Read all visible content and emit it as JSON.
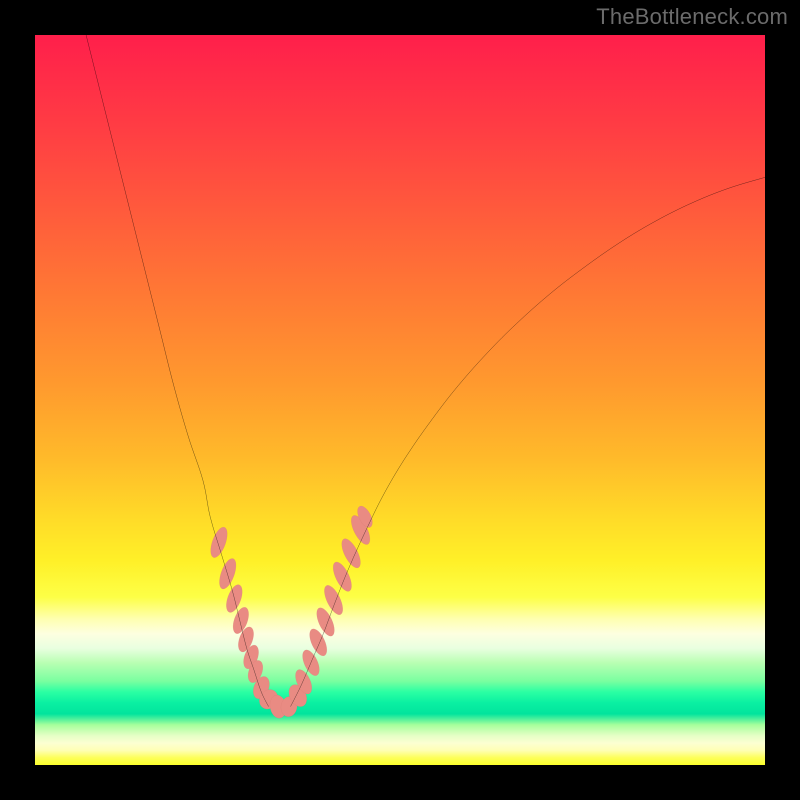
{
  "watermark": "TheBottleneck.com",
  "colors": {
    "marker_fill": "#e98b83",
    "marker_stroke": "#c66e66",
    "curve": "#000000"
  },
  "chart_data": {
    "type": "line",
    "title": "",
    "xlabel": "",
    "ylabel": "",
    "xlim": [
      0,
      100
    ],
    "ylim": [
      0,
      100
    ],
    "curve_left": {
      "comment": "Left descending branch of V curve; x in 0..100 of plot width, y in 0..100 of plot height (0=top)",
      "points": [
        [
          7,
          0
        ],
        [
          9,
          8
        ],
        [
          11,
          16
        ],
        [
          13,
          24
        ],
        [
          15,
          32
        ],
        [
          17,
          40
        ],
        [
          19,
          48
        ],
        [
          21,
          55
        ],
        [
          23,
          61
        ],
        [
          24,
          66
        ],
        [
          25.5,
          71
        ],
        [
          27,
          76
        ],
        [
          28,
          80
        ],
        [
          29,
          84
        ],
        [
          30,
          87
        ],
        [
          31,
          90
        ],
        [
          32,
          92
        ]
      ]
    },
    "curve_right": {
      "comment": "Right ascending branch of V curve",
      "points": [
        [
          35,
          92
        ],
        [
          36.5,
          89
        ],
        [
          38,
          85.5
        ],
        [
          39.5,
          82
        ],
        [
          41,
          78
        ],
        [
          43,
          73
        ],
        [
          45.5,
          67.5
        ],
        [
          48,
          62.5
        ],
        [
          51,
          57.5
        ],
        [
          54.5,
          52.5
        ],
        [
          58,
          48
        ],
        [
          62,
          43.5
        ],
        [
          66,
          39.5
        ],
        [
          70.5,
          35.5
        ],
        [
          75,
          32
        ],
        [
          80,
          28.5
        ],
        [
          85,
          25.5
        ],
        [
          90,
          23
        ],
        [
          95,
          21
        ],
        [
          100,
          19.5
        ]
      ]
    },
    "markers": {
      "comment": "Salmon elongated blobs near the valley on both branches. cx,cy,rx,ry,rot(deg) in 0..100 plot coords",
      "items": [
        [
          25.2,
          69.5,
          0.9,
          2.2,
          20
        ],
        [
          26.4,
          73.8,
          0.9,
          2.2,
          20
        ],
        [
          27.3,
          77.2,
          0.9,
          2.0,
          20
        ],
        [
          28.2,
          80.2,
          0.9,
          1.9,
          20
        ],
        [
          28.9,
          82.8,
          0.9,
          1.8,
          20
        ],
        [
          29.6,
          85.2,
          0.9,
          1.7,
          20
        ],
        [
          30.2,
          87.2,
          0.9,
          1.6,
          20
        ],
        [
          31.0,
          89.4,
          1.0,
          1.6,
          22
        ],
        [
          32.0,
          91.0,
          1.2,
          1.4,
          35
        ],
        [
          33.3,
          92.0,
          1.6,
          1.1,
          80
        ],
        [
          34.8,
          92.0,
          1.4,
          1.1,
          100
        ],
        [
          36.0,
          90.5,
          1.1,
          1.6,
          -28
        ],
        [
          36.8,
          88.6,
          0.9,
          1.8,
          -25
        ],
        [
          37.8,
          86.0,
          0.9,
          1.9,
          -25
        ],
        [
          38.8,
          83.2,
          0.9,
          2.0,
          -25
        ],
        [
          39.8,
          80.4,
          0.9,
          2.1,
          -25
        ],
        [
          40.9,
          77.4,
          0.9,
          2.2,
          -26
        ],
        [
          42.1,
          74.2,
          0.9,
          2.2,
          -26
        ],
        [
          43.3,
          71.0,
          0.9,
          2.2,
          -27
        ],
        [
          44.6,
          67.8,
          0.9,
          2.2,
          -27
        ],
        [
          45.2,
          66.0,
          0.8,
          1.6,
          -27
        ]
      ]
    }
  }
}
